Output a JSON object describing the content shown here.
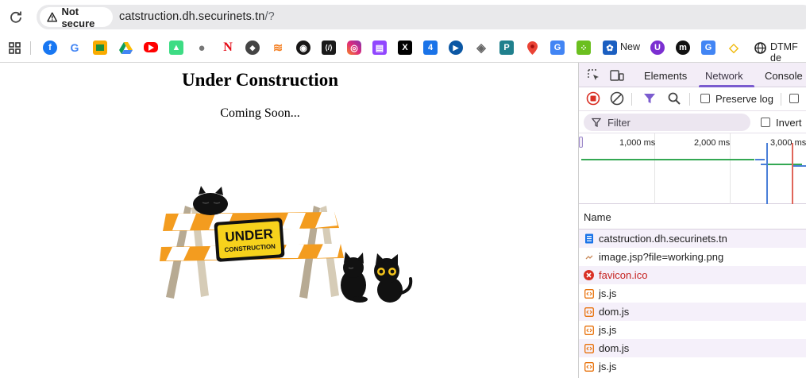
{
  "browser": {
    "security_label": "Not secure",
    "url_host": "catstruction.dh.securinets.tn",
    "url_path": "/?"
  },
  "bookmarks": {
    "icons": [
      "facebook-icon",
      "google-icon",
      "google-classroom-icon",
      "google-drive-icon",
      "youtube-icon",
      "android-icon",
      "apple-icon",
      "netflix-icon",
      "hackthebox-icon",
      "stackoverflow-icon",
      "github-icon",
      "codeforces-icon",
      "instagram-icon",
      "twitch-icon",
      "x-icon",
      "calendar-icon",
      "play-icon",
      "pdf-icon",
      "perplexity-icon",
      "google-maps-icon",
      "google-translate-icon",
      "dice-icon"
    ],
    "new_label": "New",
    "dtmf_label": "DTMF de"
  },
  "page": {
    "title": "Under Construction",
    "subtitle": "Coming Soon...",
    "sign_line1": "UNDER",
    "sign_line2": "CONSTRUCTION"
  },
  "devtools": {
    "tabs": [
      "Elements",
      "Network",
      "Console"
    ],
    "active_tab": "Network",
    "preserve_log": "Preserve log",
    "filter_placeholder": "Filter",
    "invert_label": "Invert",
    "timeline_ticks": [
      "1,000 ms",
      "2,000 ms",
      "3,000 ms"
    ],
    "name_header": "Name",
    "requests": [
      {
        "name": "catstruction.dh.securinets.tn",
        "type": "document",
        "status": "ok"
      },
      {
        "name": "image.jsp?file=working.png",
        "type": "image",
        "status": "ok"
      },
      {
        "name": "favicon.ico",
        "type": "error",
        "status": "failed"
      },
      {
        "name": "js.js",
        "type": "script",
        "status": "ok"
      },
      {
        "name": "dom.js",
        "type": "script",
        "status": "ok"
      },
      {
        "name": "js.js",
        "type": "script",
        "status": "ok"
      },
      {
        "name": "dom.js",
        "type": "script",
        "status": "ok"
      },
      {
        "name": "js.js",
        "type": "script",
        "status": "ok"
      }
    ],
    "colors": {
      "accent": "#7b5ccf",
      "error": "#c5221f",
      "record": "#d93025",
      "script": "#e8710a",
      "document": "#1a73e8"
    }
  }
}
